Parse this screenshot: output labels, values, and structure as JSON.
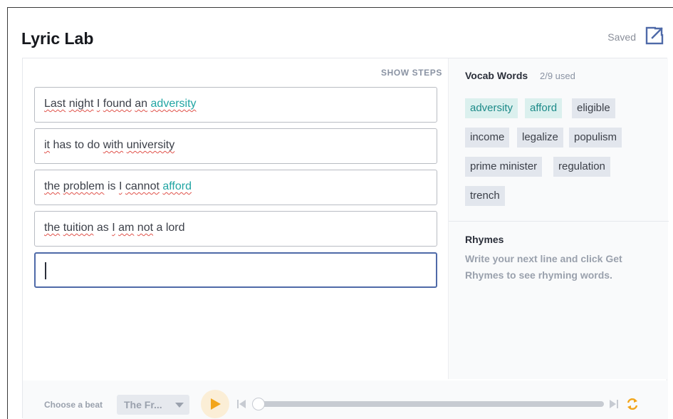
{
  "app": {
    "title": "Lyric Lab",
    "saved_label": "Saved",
    "open_icon": "open-external-icon",
    "accent": "#4f6aa8"
  },
  "editor": {
    "show_steps": "SHOW STEPS",
    "lines": [
      {
        "parts": [
          {
            "text": "Last",
            "style": "sq"
          },
          {
            "text": " "
          },
          {
            "text": "night",
            "style": "sq"
          },
          {
            "text": " "
          },
          {
            "text": "I",
            "style": "sq"
          },
          {
            "text": " "
          },
          {
            "text": "found",
            "style": "sq"
          },
          {
            "text": " "
          },
          {
            "text": "an",
            "style": "sq"
          },
          {
            "text": " "
          },
          {
            "text": "adversity",
            "style": "vocab"
          }
        ]
      },
      {
        "parts": [
          {
            "text": "it",
            "style": "sq"
          },
          {
            "text": " has to do "
          },
          {
            "text": "with",
            "style": "sq"
          },
          {
            "text": " "
          },
          {
            "text": "university",
            "style": "sq"
          }
        ]
      },
      {
        "parts": [
          {
            "text": "the",
            "style": "sq"
          },
          {
            "text": " "
          },
          {
            "text": "problem",
            "style": "sq"
          },
          {
            "text": " is "
          },
          {
            "text": "I",
            "style": "sq"
          },
          {
            "text": " "
          },
          {
            "text": "cannot",
            "style": "sq"
          },
          {
            "text": " "
          },
          {
            "text": "afford",
            "style": "vocab"
          }
        ]
      },
      {
        "parts": [
          {
            "text": "the",
            "style": "sq"
          },
          {
            "text": " "
          },
          {
            "text": "tuition",
            "style": "sq"
          },
          {
            "text": " as "
          },
          {
            "text": "I",
            "style": "sq"
          },
          {
            "text": " "
          },
          {
            "text": "am",
            "style": "sq"
          },
          {
            "text": " "
          },
          {
            "text": "not",
            "style": "sq"
          },
          {
            "text": " a lord"
          }
        ]
      }
    ],
    "new_line_value": ""
  },
  "vocab": {
    "title": "Vocab Words",
    "count": "2/9 used",
    "words": [
      {
        "label": "adversity",
        "used": true
      },
      {
        "label": "afford",
        "used": true
      },
      {
        "label": "eligible",
        "used": false
      },
      {
        "label": "income",
        "used": false
      },
      {
        "label": "legalize",
        "used": false
      },
      {
        "label": "populism",
        "used": false
      },
      {
        "label": "prime minister",
        "used": false
      },
      {
        "label": "regulation",
        "used": false
      },
      {
        "label": "trench",
        "used": false
      }
    ],
    "used_color": "#21a5a3"
  },
  "rhymes": {
    "title": "Rhymes",
    "hint": "Write your next line and click Get Rhymes to see rhyming words."
  },
  "player": {
    "choose_label": "Choose a beat",
    "beat_value": "The Fr...",
    "play_icon": "play-icon",
    "skip_back_icon": "skip-back-icon",
    "skip_forward_icon": "skip-forward-icon",
    "loop_icon": "loop-icon",
    "progress": 0,
    "accent": "#f2a51a"
  }
}
